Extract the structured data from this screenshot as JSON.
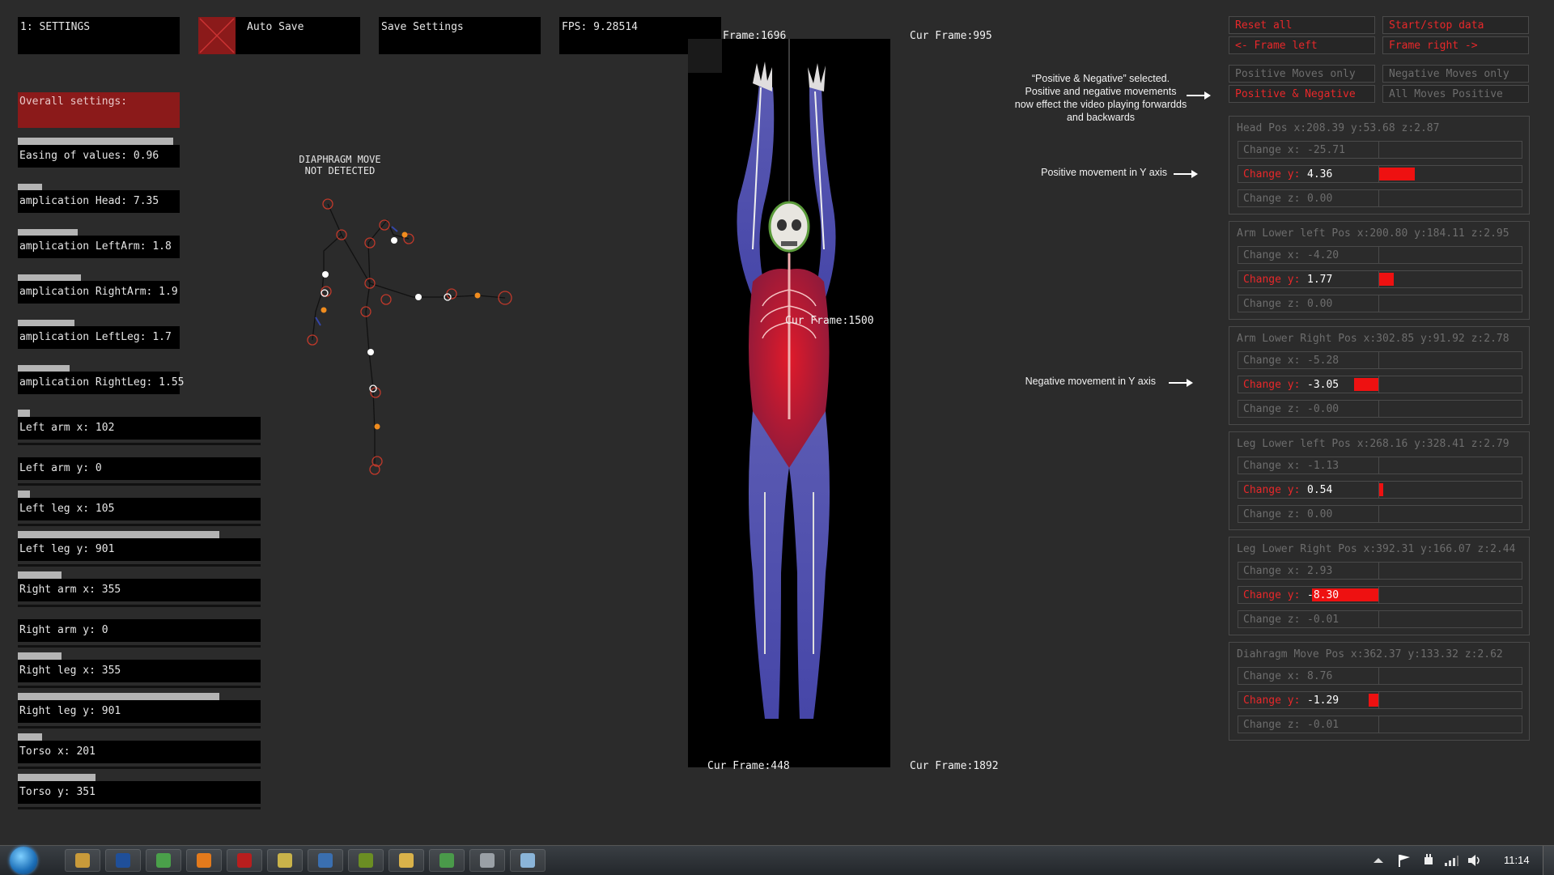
{
  "top_bar": {
    "settings_label": "1: SETTINGS",
    "autosave_label": "Auto Save",
    "save_settings_label": "Save Settings",
    "fps_label": "FPS: 9.28514"
  },
  "left_panel": {
    "overall_label": "Overall settings:",
    "easing_label": "Easing of values: 0.96",
    "sliders": [
      {
        "label": "amplication Head: 7.35",
        "level": 0.15
      },
      {
        "label": "amplication LeftArm: 1.8",
        "level": 0.37
      },
      {
        "label": "amplication RightArm: 1.9",
        "level": 0.39
      },
      {
        "label": "amplication LeftLeg: 1.7",
        "level": 0.35
      },
      {
        "label": "amplication RightLeg: 1.55",
        "level": 0.32
      }
    ],
    "positions": [
      {
        "label": "Left arm x: 102",
        "level": 0.05
      },
      {
        "label": "Left arm y: 0",
        "level": 0
      },
      {
        "label": "Left leg x: 105",
        "level": 0.05
      },
      {
        "label": "Left leg y: 901",
        "level": 0.83
      },
      {
        "label": "Right arm x: 355",
        "level": 0.18
      },
      {
        "label": "Right arm y: 0",
        "level": 0
      },
      {
        "label": "Right leg x: 355",
        "level": 0.18
      },
      {
        "label": "Right leg y: 901",
        "level": 0.83
      },
      {
        "label": "Torso x: 201",
        "level": 0.1
      },
      {
        "label": "Torso y: 351",
        "level": 0.32
      }
    ]
  },
  "diaphragm_status": "DIAPHRAGM MOVE\nNOT DETECTED",
  "frames": {
    "top_left": "Frame:1696",
    "top_right": "Cur Frame:995",
    "middle": "Cur Frame:1500",
    "bottom_left": "Cur Frame:448",
    "bottom_right": "Cur Frame:1892"
  },
  "annotations": {
    "selected_note": "“Positive & Negative” selected.\nPositive and negative movements\nnow effect the video playing forwardds\nand backwards",
    "positive_note": "Positive movement in Y axis",
    "negative_note": "Negative movement in Y axis"
  },
  "right_panel": {
    "buttons": {
      "reset_all": "Reset all",
      "start_stop": "Start/stop data",
      "frame_left": "<- Frame left",
      "frame_right": "Frame right ->",
      "positive_only": "Positive Moves only",
      "negative_only": "Negative Moves only",
      "pos_neg": "Positive & Negative",
      "all_positive": "All Moves Positive"
    },
    "groups": [
      {
        "title": "Head Pos x:208.39 y:53.68 z:2.87",
        "x": "-25.71",
        "y": "4.36",
        "z": "0.00",
        "y_level": 4.36
      },
      {
        "title": "Arm Lower left Pos x:200.80 y:184.11 z:2.95",
        "x": "-4.20",
        "y": "1.77",
        "z": "0.00",
        "y_level": 1.77
      },
      {
        "title": "Arm Lower Right Pos x:302.85 y:91.92 z:2.78",
        "x": "-5.28",
        "y": "-3.05",
        "z": "-0.00",
        "y_level": -3.05
      },
      {
        "title": "Leg Lower left Pos x:268.16 y:328.41 z:2.79",
        "x": "-1.13",
        "y": "0.54",
        "z": "0.00",
        "y_level": 0.54
      },
      {
        "title": "Leg Lower Right Pos x:392.31 y:166.07 z:2.44",
        "x": "2.93",
        "y": "-8.30",
        "z": "-0.01",
        "y_level": -8.3
      },
      {
        "title": "Diahragm Move Pos x:362.37 y:133.32 z:2.62",
        "x": "8.76",
        "y": "-1.29",
        "z": "-0.01",
        "y_level": -1.29
      }
    ],
    "change_x_caption": "Change x:",
    "change_y_caption": "Change y:",
    "change_z_caption": "Change z:"
  },
  "taskbar": {
    "clock": "11:14",
    "icons": [
      "start-orb-icon",
      "media-player-icon",
      "photoshop-icon",
      "chrome-icon",
      "firefox-icon",
      "filezilla-icon",
      "image-viewer-icon",
      "network-app-icon",
      "dreamweaver-icon",
      "explorer-folder-icon",
      "paint-icon",
      "window-app-icon",
      "active-window-icon"
    ]
  },
  "colors": {
    "accent_red": "#e8282a",
    "panel_bg": "#2b2b2b",
    "fill_red": "#ee1111"
  }
}
